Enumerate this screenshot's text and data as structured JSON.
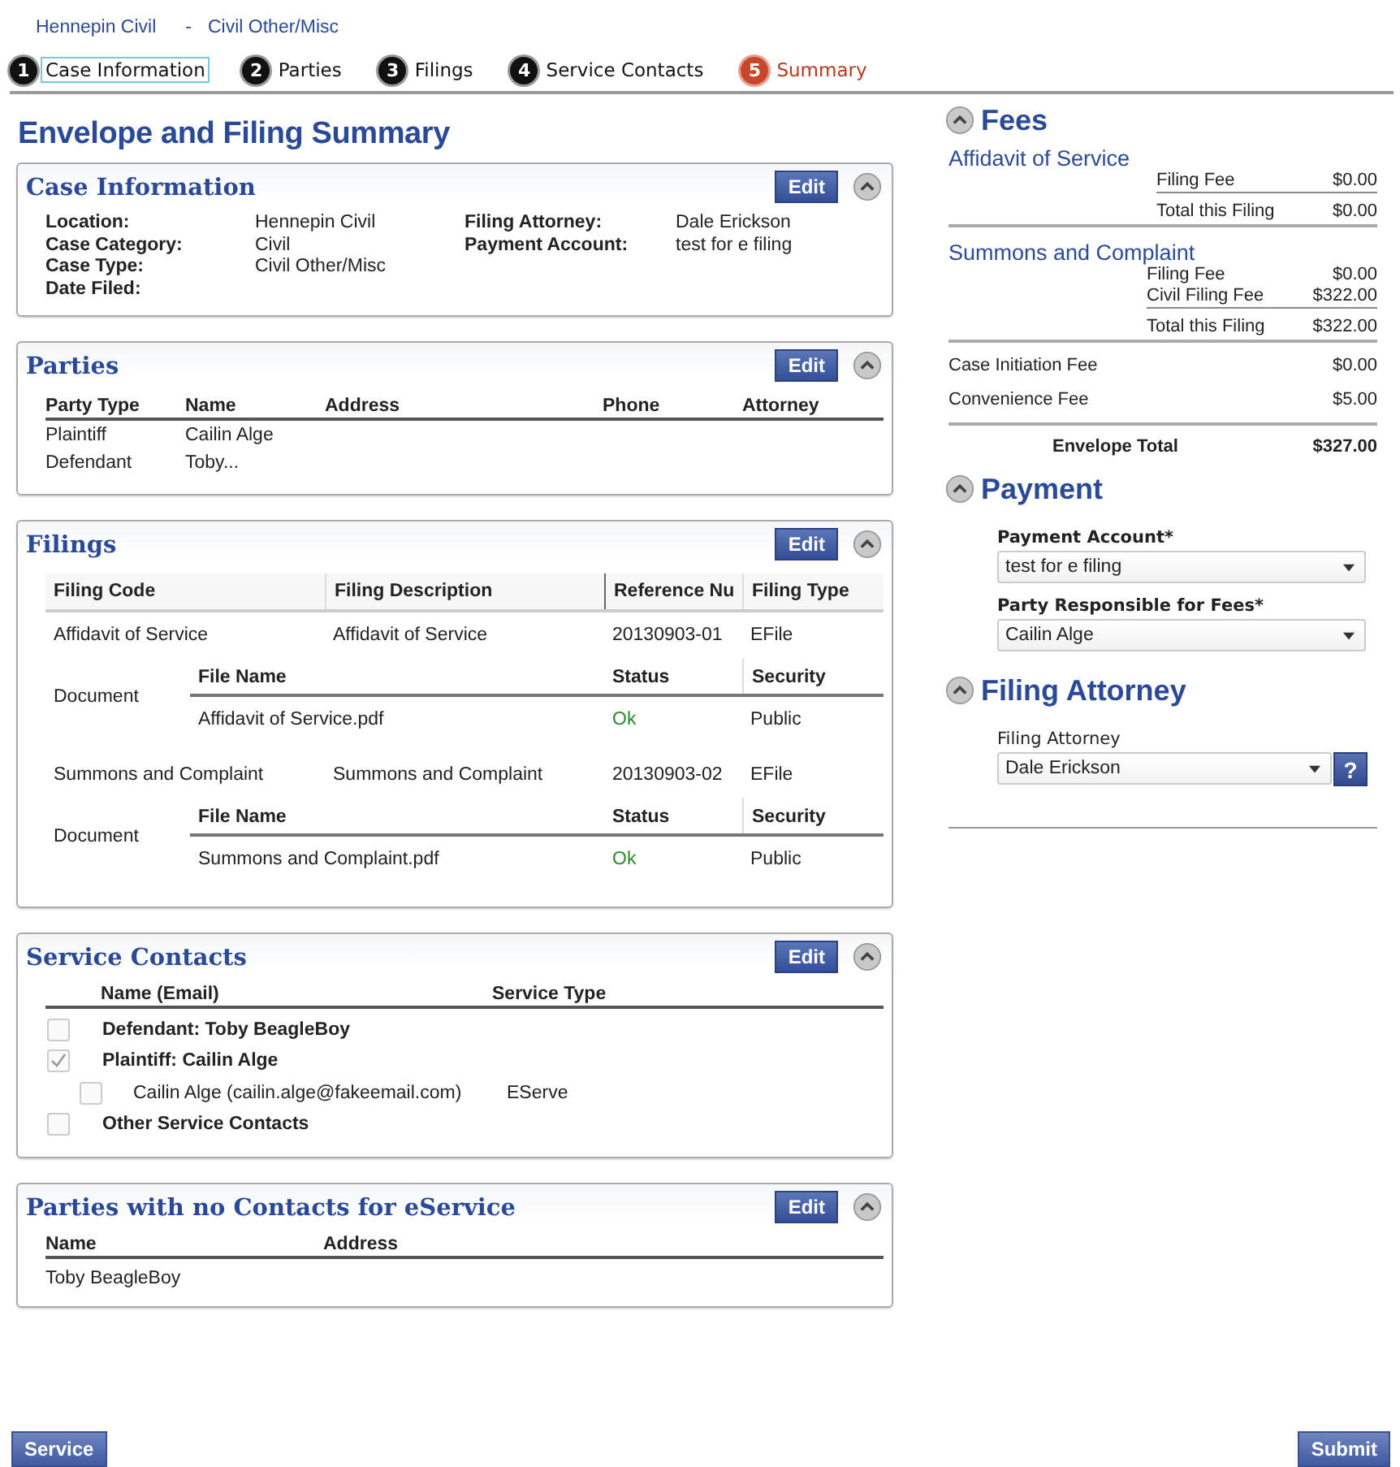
{
  "breadcrumb": {
    "court": "Hennepin Civil",
    "separator": "-",
    "case_type": "Civil Other/Misc"
  },
  "steps": [
    {
      "number": "1",
      "label": "Case Information",
      "selected": false,
      "focused": true
    },
    {
      "number": "2",
      "label": "Parties",
      "selected": false,
      "focused": false
    },
    {
      "number": "3",
      "label": "Filings",
      "selected": false,
      "focused": false
    },
    {
      "number": "4",
      "label": "Service Contacts",
      "selected": false,
      "focused": false
    },
    {
      "number": "5",
      "label": "Summary",
      "selected": true,
      "focused": false
    }
  ],
  "page_title": "Envelope and Filing Summary",
  "sections": [
    {
      "kind": "case_info",
      "title": "Case Information",
      "edit": "Edit",
      "fields_left": [
        {
          "label": "Location:",
          "value": "Hennepin Civil"
        },
        {
          "label": "Case Category:",
          "value": "Civil"
        },
        {
          "label": "Case Type:",
          "value": "Civil Other/Misc"
        },
        {
          "label": "Date Filed:"
        }
      ],
      "fields_right": [
        {
          "label": "Filing Attorney:",
          "value": "Dale Erickson"
        },
        {
          "label": "Payment Account:",
          "value": "test for e filing"
        }
      ]
    },
    {
      "kind": "parties",
      "title": "Parties",
      "edit": "Edit",
      "columns": [
        "Party Type",
        "Name",
        "Address",
        "Phone",
        "Attorney"
      ],
      "rows": [
        [
          "Plaintiff",
          "Cailin Alge"
        ],
        [
          "Defendant",
          "Toby..."
        ]
      ]
    },
    {
      "kind": "filings",
      "title": "Filings",
      "edit": "Edit",
      "columns": [
        "Filing Code",
        "Filing Description",
        "Reference Nu",
        "Filing Type"
      ],
      "filings": [
        {
          "cells": [
            "Affidavit of Service",
            "Affidavit of Service",
            "20130903-01",
            "EFile"
          ],
          "document": {
            "label": "Document",
            "columns": [
              "File Name",
              "Status",
              "Security"
            ],
            "file": "Affidavit of Service.pdf",
            "status": "Ok",
            "security": "Public"
          }
        },
        {
          "cells": [
            "Summons and Complaint",
            "Summons and Complaint",
            "20130903-02",
            "EFile"
          ],
          "document": {
            "label": "Document",
            "columns": [
              "File Name",
              "Status",
              "Security"
            ],
            "file": "Summons and Complaint.pdf",
            "status": "Ok",
            "security": "Public"
          }
        }
      ]
    },
    {
      "kind": "service_contacts",
      "title": "Service Contacts",
      "edit": "Edit",
      "columns": [
        "Name (Email)",
        "Service Type"
      ],
      "contacts": [
        {
          "label": "Defendant: Toby BeagleBoy",
          "checked": false
        },
        {
          "label": "Plaintiff: Cailin Alge",
          "checked": true,
          "children": [
            {
              "name": "Cailin Alge (cailin.alge@fakeemail.com)",
              "service_type": "EServe",
              "checked": false
            }
          ]
        },
        {
          "label": "Other Service Contacts",
          "checked": false
        }
      ]
    },
    {
      "kind": "no_contacts",
      "title": "Parties with no Contacts for eService",
      "edit": "Edit",
      "columns": [
        "Name",
        "Address"
      ],
      "rows": [
        [
          "Toby BeagleBoy"
        ]
      ]
    }
  ],
  "fees": {
    "title": "Fees",
    "filings": [
      {
        "name": "Affidavit of Service",
        "lines": [
          {
            "label": "Filing Fee",
            "amount": "$0.00"
          }
        ],
        "total": {
          "label": "Total this Filing",
          "amount": "$0.00"
        }
      },
      {
        "name": "Summons and Complaint",
        "lines": [
          {
            "label": "Filing Fee",
            "amount": "$0.00"
          },
          {
            "label": "Civil Filing Fee",
            "amount": "$322.00"
          }
        ],
        "total": {
          "label": "Total this Filing",
          "amount": "$322.00"
        }
      }
    ],
    "other": [
      {
        "label": "Case Initiation Fee",
        "amount": "$0.00"
      },
      {
        "label": "Convenience Fee",
        "amount": "$5.00"
      }
    ],
    "envelope_total": {
      "label": "Envelope Total",
      "amount": "$327.00"
    }
  },
  "payment": {
    "title": "Payment",
    "fields": [
      {
        "label": "Payment Account*",
        "value": "test for e filing"
      },
      {
        "label": "Party Responsible for Fees*",
        "value": "Cailin Alge"
      }
    ]
  },
  "filing_attorney": {
    "title": "Filing Attorney",
    "label": "Filing Attorney",
    "value": "Dale Erickson",
    "help": "?"
  },
  "buttons": {
    "left": "Service",
    "right": "Submit"
  }
}
